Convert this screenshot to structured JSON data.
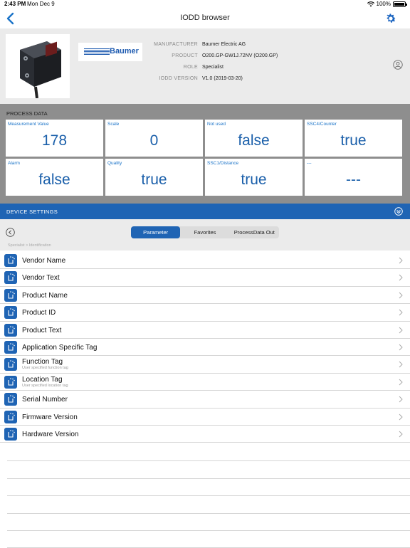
{
  "status_bar": {
    "time": "2:43 PM",
    "date": "Mon Dec 9",
    "battery": "100%"
  },
  "nav": {
    "title": "IODD browser"
  },
  "device": {
    "brand": "Baumer",
    "info": [
      {
        "label": "MANUFACTURER",
        "value": "Baumer Electric AG"
      },
      {
        "label": "PRODUCT",
        "value": "O200.GP-GW1J.72NV (O200.GP)"
      },
      {
        "label": "ROLE",
        "value": "Specialist"
      },
      {
        "label": "IODD VERSION",
        "value": "V1.0 (2019-03-20)"
      }
    ]
  },
  "process_data": {
    "title": "PROCESS DATA",
    "cells": [
      {
        "label": "Measurement Value",
        "value": "178"
      },
      {
        "label": "Scale",
        "value": "0"
      },
      {
        "label": "Not used",
        "value": "false"
      },
      {
        "label": "SSC4/Counter",
        "value": "true"
      },
      {
        "label": "Alarm",
        "value": "false"
      },
      {
        "label": "Quality",
        "value": "true"
      },
      {
        "label": "SSC1/Distance",
        "value": "true"
      },
      {
        "label": "---",
        "value": "---"
      }
    ]
  },
  "device_settings": {
    "title": "DEVICE SETTINGS",
    "tabs": [
      {
        "label": "Parameter",
        "active": true
      },
      {
        "label": "Favorites",
        "active": false
      },
      {
        "label": "ProcessData Out",
        "active": false
      }
    ],
    "breadcrumb": "Specialist > Identification"
  },
  "parameters": [
    {
      "label": "Vendor Name",
      "sub": ""
    },
    {
      "label": "Vendor Text",
      "sub": ""
    },
    {
      "label": "Product Name",
      "sub": ""
    },
    {
      "label": "Product ID",
      "sub": ""
    },
    {
      "label": "Product Text",
      "sub": ""
    },
    {
      "label": "Application Specific Tag",
      "sub": ""
    },
    {
      "label": "Function Tag",
      "sub": "User specified function tag"
    },
    {
      "label": "Location Tag",
      "sub": "User specified location tag"
    },
    {
      "label": "Serial Number",
      "sub": ""
    },
    {
      "label": "Firmware Version",
      "sub": ""
    },
    {
      "label": "Hardware Version",
      "sub": ""
    }
  ],
  "colors": {
    "accent": "#1f64b4",
    "value_text": "#1a5faa",
    "header_bg": "#ebebeb",
    "process_bg": "#8e8e8e"
  },
  "icons": {
    "back": "chevron-left-icon",
    "settings": "gear-icon",
    "profile": "person-circle-icon",
    "parameter": "parameter-icon",
    "chevron": "chevron-right-icon"
  }
}
